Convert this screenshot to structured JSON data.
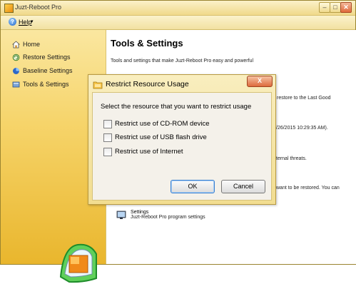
{
  "window": {
    "title": "Juzt-Reboot Pro",
    "controls": {
      "minimize": "–",
      "maximize": "□",
      "close": "✕"
    }
  },
  "menu": {
    "help_label": "Help",
    "help_arrow": "▾"
  },
  "sidebar": {
    "items": [
      {
        "label": "Home",
        "icon": "home-icon"
      },
      {
        "label": "Restore Settings",
        "icon": "restore-icon"
      },
      {
        "label": "Baseline Settings",
        "icon": "baseline-icon"
      },
      {
        "label": "Tools & Settings",
        "icon": "tools-icon"
      }
    ]
  },
  "content": {
    "title": "Tools & Settings",
    "description": "Tools and settings that make Juzt-Reboot Pro easy and powerful",
    "fragments": [
      "restore to the Last Good",
      "/26/2015 10:29:35 AM).",
      "ternal threats.",
      "want to be restored. You can"
    ],
    "settings": {
      "title": "Settings",
      "description": "Juzt-Reboot Pro program settings"
    }
  },
  "dialog": {
    "title": "Restrict Resource Usage",
    "close_label": "X",
    "prompt": "Select the resource that you want to restrict usage",
    "options": [
      {
        "label": "Restrict use of CD-ROM device",
        "checked": false
      },
      {
        "label": "Restrict use of USB flash drive",
        "checked": false
      },
      {
        "label": "Restrict use of Internet",
        "checked": false
      }
    ],
    "ok_label": "OK",
    "cancel_label": "Cancel"
  },
  "colors": {
    "accent": "#f0c23c",
    "close_button": "#dd6a3c",
    "frame": "#b89a42"
  }
}
